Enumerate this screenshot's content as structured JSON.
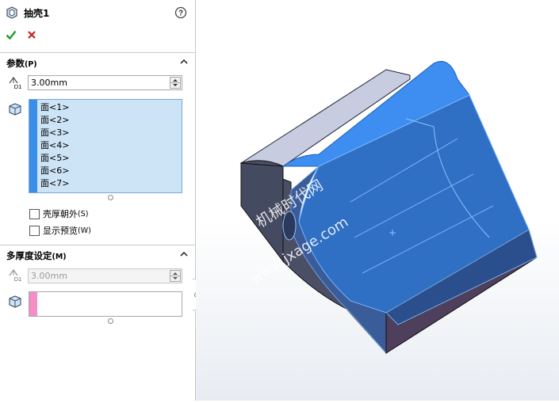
{
  "window": {
    "title": "抽壳1",
    "help_icon": "help-icon"
  },
  "actions": {
    "ok_icon": "ok-checkmark-icon",
    "cancel_icon": "cancel-x-icon"
  },
  "parameters": {
    "header": "参数",
    "header_suffix": "(P)",
    "thickness": "3.00mm",
    "faces": [
      "面<1>",
      "面<2>",
      "面<3>",
      "面<4>",
      "面<5>",
      "面<6>",
      "面<7>"
    ],
    "faces_bar_color": "#3b8ee8",
    "shell_outward": "壳厚朝外",
    "shell_outward_key": "(S)",
    "show_preview": "显示预览",
    "show_preview_key": "(W)"
  },
  "multi_thickness": {
    "header": "多厚度设定",
    "header_suffix": "(M)",
    "thickness": "3.00mm",
    "faces_bar_color": "#f18fc6"
  },
  "viewport": {
    "watermark_line1": "机械时代网",
    "watermark_line2": "www.jxage.com",
    "model_accent": "#3d8ef0",
    "model_body": "#3b4a6b"
  }
}
